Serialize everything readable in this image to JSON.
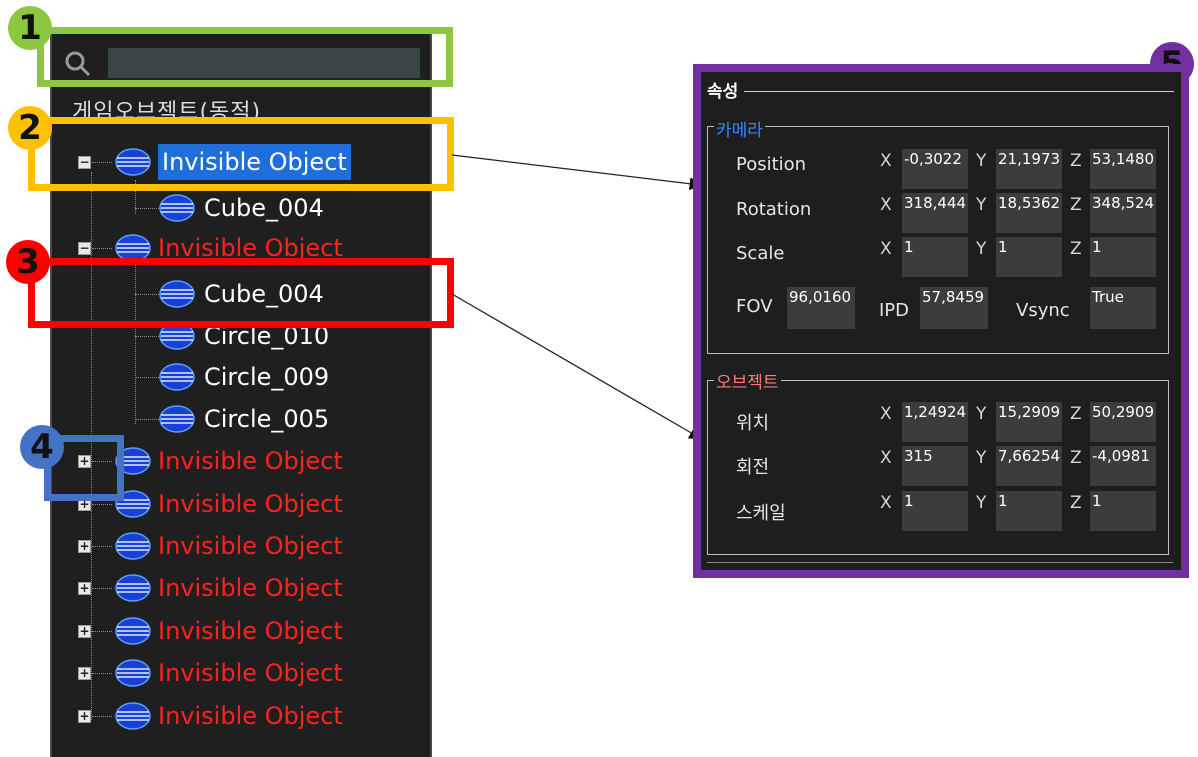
{
  "annotations": [
    "1",
    "2",
    "3",
    "4",
    "5"
  ],
  "colors": {
    "annotation_1": "#8dc63f",
    "annotation_2": "#ffc000",
    "annotation_3": "#ff0000",
    "annotation_4": "#4472c4",
    "annotation_5": "#7030a0",
    "selected_bg": "#1e6fdc",
    "inactive_text": "#ff2020",
    "camera_group": "#2e8bff",
    "object_group": "#ff7b7b"
  },
  "tree": {
    "header": "게임오브젝트(동적)",
    "search_placeholder": "",
    "rows": [
      {
        "label": "Invisible Object",
        "state": "expanded",
        "style": "selected",
        "icon": "object-icon"
      },
      {
        "label": "Cube_004",
        "style": "white",
        "icon": "object-icon"
      },
      {
        "label": "Invisible Object",
        "state": "expanded",
        "style": "red",
        "icon": "object-icon"
      },
      {
        "label": "Cube_004",
        "style": "white",
        "icon": "object-icon"
      },
      {
        "label": "Circle_010",
        "style": "white",
        "icon": "object-icon"
      },
      {
        "label": "Circle_009",
        "style": "white",
        "icon": "object-icon"
      },
      {
        "label": "Circle_005",
        "style": "white",
        "icon": "object-icon"
      },
      {
        "label": "Invisible Object",
        "state": "collapsed",
        "style": "red",
        "icon": "object-icon"
      },
      {
        "label": "Invisible Object",
        "state": "collapsed",
        "style": "red",
        "icon": "object-icon"
      },
      {
        "label": "Invisible Object",
        "state": "collapsed",
        "style": "red",
        "icon": "object-icon"
      },
      {
        "label": "Invisible Object",
        "state": "collapsed",
        "style": "red",
        "icon": "object-icon"
      },
      {
        "label": "Invisible Object",
        "state": "collapsed",
        "style": "red",
        "icon": "object-icon"
      },
      {
        "label": "Invisible Object",
        "state": "collapsed",
        "style": "red",
        "icon": "object-icon"
      },
      {
        "label": "Invisible Object",
        "state": "collapsed",
        "style": "red",
        "icon": "object-icon"
      }
    ],
    "toggle_expanded": "−",
    "toggle_collapsed": "+"
  },
  "properties": {
    "title": "속성",
    "camera": {
      "title": "카메라",
      "position_label": "Position",
      "rotation_label": "Rotation",
      "scale_label": "Scale",
      "position": {
        "x": "-0,3022",
        "y": "21,1973",
        "z": "53,1480"
      },
      "rotation": {
        "x": "318,444",
        "y": "18,5362",
        "z": "348,524"
      },
      "scale": {
        "x": "1",
        "y": "1",
        "z": "1"
      },
      "fov_label": "FOV",
      "fov": "96,0160",
      "ipd_label": "IPD",
      "ipd": "57,8459",
      "vsync_label": "Vsync",
      "vsync": "True"
    },
    "object": {
      "title": "오브젝트",
      "position_label": "위치",
      "rotation_label": "회전",
      "scale_label": "스케일",
      "position": {
        "x": "1,24924",
        "y": "15,2909",
        "z": "50,2909"
      },
      "rotation": {
        "x": "315",
        "y": "7,66254",
        "z": "-4,0981"
      },
      "scale": {
        "x": "1",
        "y": "1",
        "z": "1"
      }
    },
    "axis_labels": {
      "x": "X",
      "y": "Y",
      "z": "Z"
    }
  }
}
